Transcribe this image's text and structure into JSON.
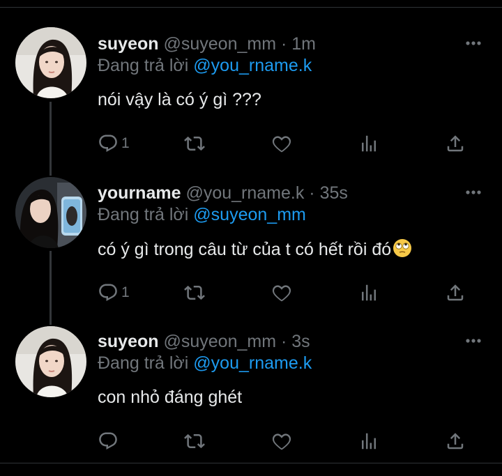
{
  "tweets": [
    {
      "name": "suyeon",
      "handle": "@suyeon_mm",
      "time": "· 1m",
      "replying_prefix": "Đang trả lời",
      "replying_to": "@you_rname.k",
      "text": "nói vậy là có ý gì ???",
      "reply_count": "1",
      "avatar": "avatar-suyeon"
    },
    {
      "name": "yourname",
      "handle": "@you_rname.k",
      "time": "· 35s",
      "replying_prefix": "Đang trả lời",
      "replying_to": "@suyeon_mm",
      "text": "có ý gì trong câu từ của t có hết rồi đó",
      "text_emoji": "face-with-rolling-eyes",
      "reply_count": "1",
      "avatar": "avatar-yourname"
    },
    {
      "name": "suyeon",
      "handle": "@suyeon_mm",
      "time": "· 3s",
      "replying_prefix": "Đang trả lời",
      "replying_to": "@you_rname.k",
      "text": "con nhỏ đáng ghét",
      "reply_count": "",
      "avatar": "avatar-suyeon"
    }
  ],
  "colors": {
    "background": "#000000",
    "text": "#e7e9ea",
    "muted": "#71767b",
    "accent": "#1d9bf0",
    "divider": "#2f3336"
  },
  "icons": [
    "more-icon",
    "reply-icon",
    "retweet-icon",
    "like-icon",
    "views-icon",
    "share-icon"
  ]
}
